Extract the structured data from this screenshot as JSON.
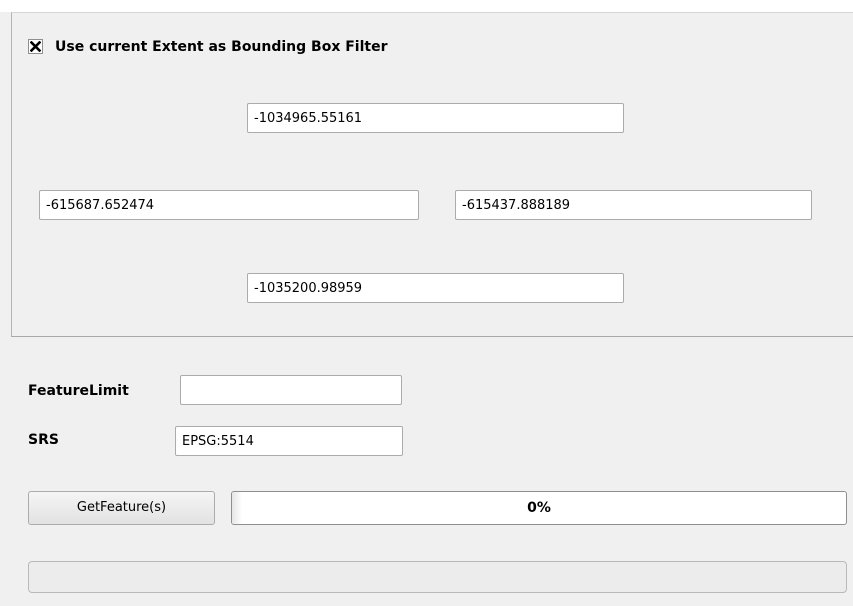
{
  "bbox_filter": {
    "checkbox_label": "Use current Extent as Bounding Box Filter",
    "checked": true,
    "north": "-1034965.55161",
    "west": "-615687.652474",
    "east": "-615437.888189",
    "south": "-1035200.98959"
  },
  "feature_limit": {
    "label": "FeatureLimit",
    "value": ""
  },
  "srs": {
    "label": "SRS",
    "value": "EPSG:5514"
  },
  "actions": {
    "get_feature_label": "GetFeature(s)"
  },
  "progress": {
    "value": 0,
    "text": "0%"
  }
}
